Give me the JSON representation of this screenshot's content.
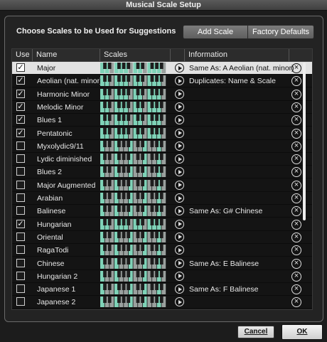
{
  "window": {
    "title": "Musical Scale Setup"
  },
  "header": {
    "choose_label": "Choose Scales to be Used for Suggestions",
    "add_scale": "Add Scale",
    "factory_defaults": "Factory Defaults"
  },
  "table": {
    "columns": {
      "use": "Use",
      "name": "Name",
      "scales": "Scales",
      "information": "Information"
    },
    "rows": [
      {
        "name": "Major",
        "checked": true,
        "info": "Same As:  A Aeolian (nat. minor)",
        "selected": true
      },
      {
        "name": "Aeolian (nat. minor)",
        "checked": true,
        "info": "Duplicates: Name & Scale"
      },
      {
        "name": "Harmonic Minor",
        "checked": true,
        "info": ""
      },
      {
        "name": "Melodic Minor",
        "checked": true,
        "info": ""
      },
      {
        "name": "Blues 1",
        "checked": true,
        "info": ""
      },
      {
        "name": "Pentatonic",
        "checked": true,
        "info": ""
      },
      {
        "name": "Myxolydic9/11",
        "checked": false,
        "info": ""
      },
      {
        "name": "Lydic diminished",
        "checked": false,
        "info": ""
      },
      {
        "name": "Blues 2",
        "checked": false,
        "info": ""
      },
      {
        "name": "Major Augmented",
        "checked": false,
        "info": ""
      },
      {
        "name": "Arabian",
        "checked": false,
        "info": ""
      },
      {
        "name": "Balinese",
        "checked": false,
        "info": "Same As:  G# Chinese"
      },
      {
        "name": "Hungarian",
        "checked": true,
        "info": ""
      },
      {
        "name": "Oriental",
        "checked": false,
        "info": ""
      },
      {
        "name": "RagaTodi",
        "checked": false,
        "info": ""
      },
      {
        "name": "Chinese",
        "checked": false,
        "info": "Same As:  E Balinese"
      },
      {
        "name": "Hungarian 2",
        "checked": false,
        "info": ""
      },
      {
        "name": "Japanese 1",
        "checked": false,
        "info": "Same As:  F Balinese"
      },
      {
        "name": "Japanese 2",
        "checked": false,
        "info": ""
      }
    ]
  },
  "footer": {
    "cancel": "Cancel",
    "ok": "OK"
  },
  "icons": {
    "play": "play-circle-icon",
    "delete": "close-circle-icon",
    "checkmark": "checkmark-icon"
  },
  "colors": {
    "key_highlight": "#7fd3b8",
    "key_base": "#9aa09e",
    "black_key": "#1e1e1e",
    "selected_row": "#e2e2e2"
  }
}
